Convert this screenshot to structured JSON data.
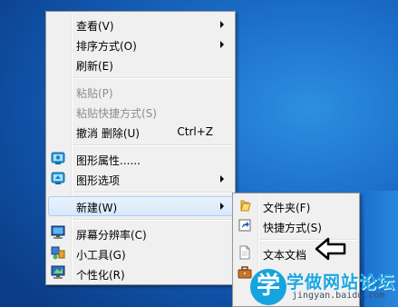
{
  "context_menu": {
    "items": [
      {
        "label": "查看(V)",
        "has_submenu": true
      },
      {
        "label": "排序方式(O)",
        "has_submenu": true
      },
      {
        "label": "刷新(E)"
      },
      {
        "label": "粘贴(P)",
        "disabled": true
      },
      {
        "label": "粘贴快捷方式(S)",
        "disabled": true
      },
      {
        "label": "撤消 删除(U)",
        "shortcut": "Ctrl+Z"
      },
      {
        "label": "图形属性......",
        "icon": "graphics-properties-icon"
      },
      {
        "label": "图形选项",
        "icon": "graphics-options-icon",
        "has_submenu": true
      },
      {
        "label": "新建(W)",
        "has_submenu": true,
        "highlighted": true
      },
      {
        "label": "屏幕分辨率(C)",
        "icon": "screen-resolution-icon"
      },
      {
        "label": "小工具(G)",
        "icon": "gadgets-icon"
      },
      {
        "label": "个性化(R)",
        "icon": "personalize-icon"
      }
    ]
  },
  "new_submenu": {
    "items": [
      {
        "label": "文件夹(F)",
        "icon": "folder-icon"
      },
      {
        "label": "快捷方式(S)",
        "icon": "shortcut-icon"
      },
      {
        "label": "文本文档",
        "icon": "text-document-icon"
      },
      {
        "label": "",
        "icon": "briefcase-icon"
      }
    ]
  },
  "pointer_arrow": "arrow-outline-icon",
  "watermark": {
    "badge": "学",
    "title": "学做网站论坛",
    "url": "jingyan.baidu.com"
  },
  "colors": {
    "desktop": "#1a6bc6",
    "menu_bg": "#f0f0f0",
    "highlight": "#d6e8fb"
  }
}
